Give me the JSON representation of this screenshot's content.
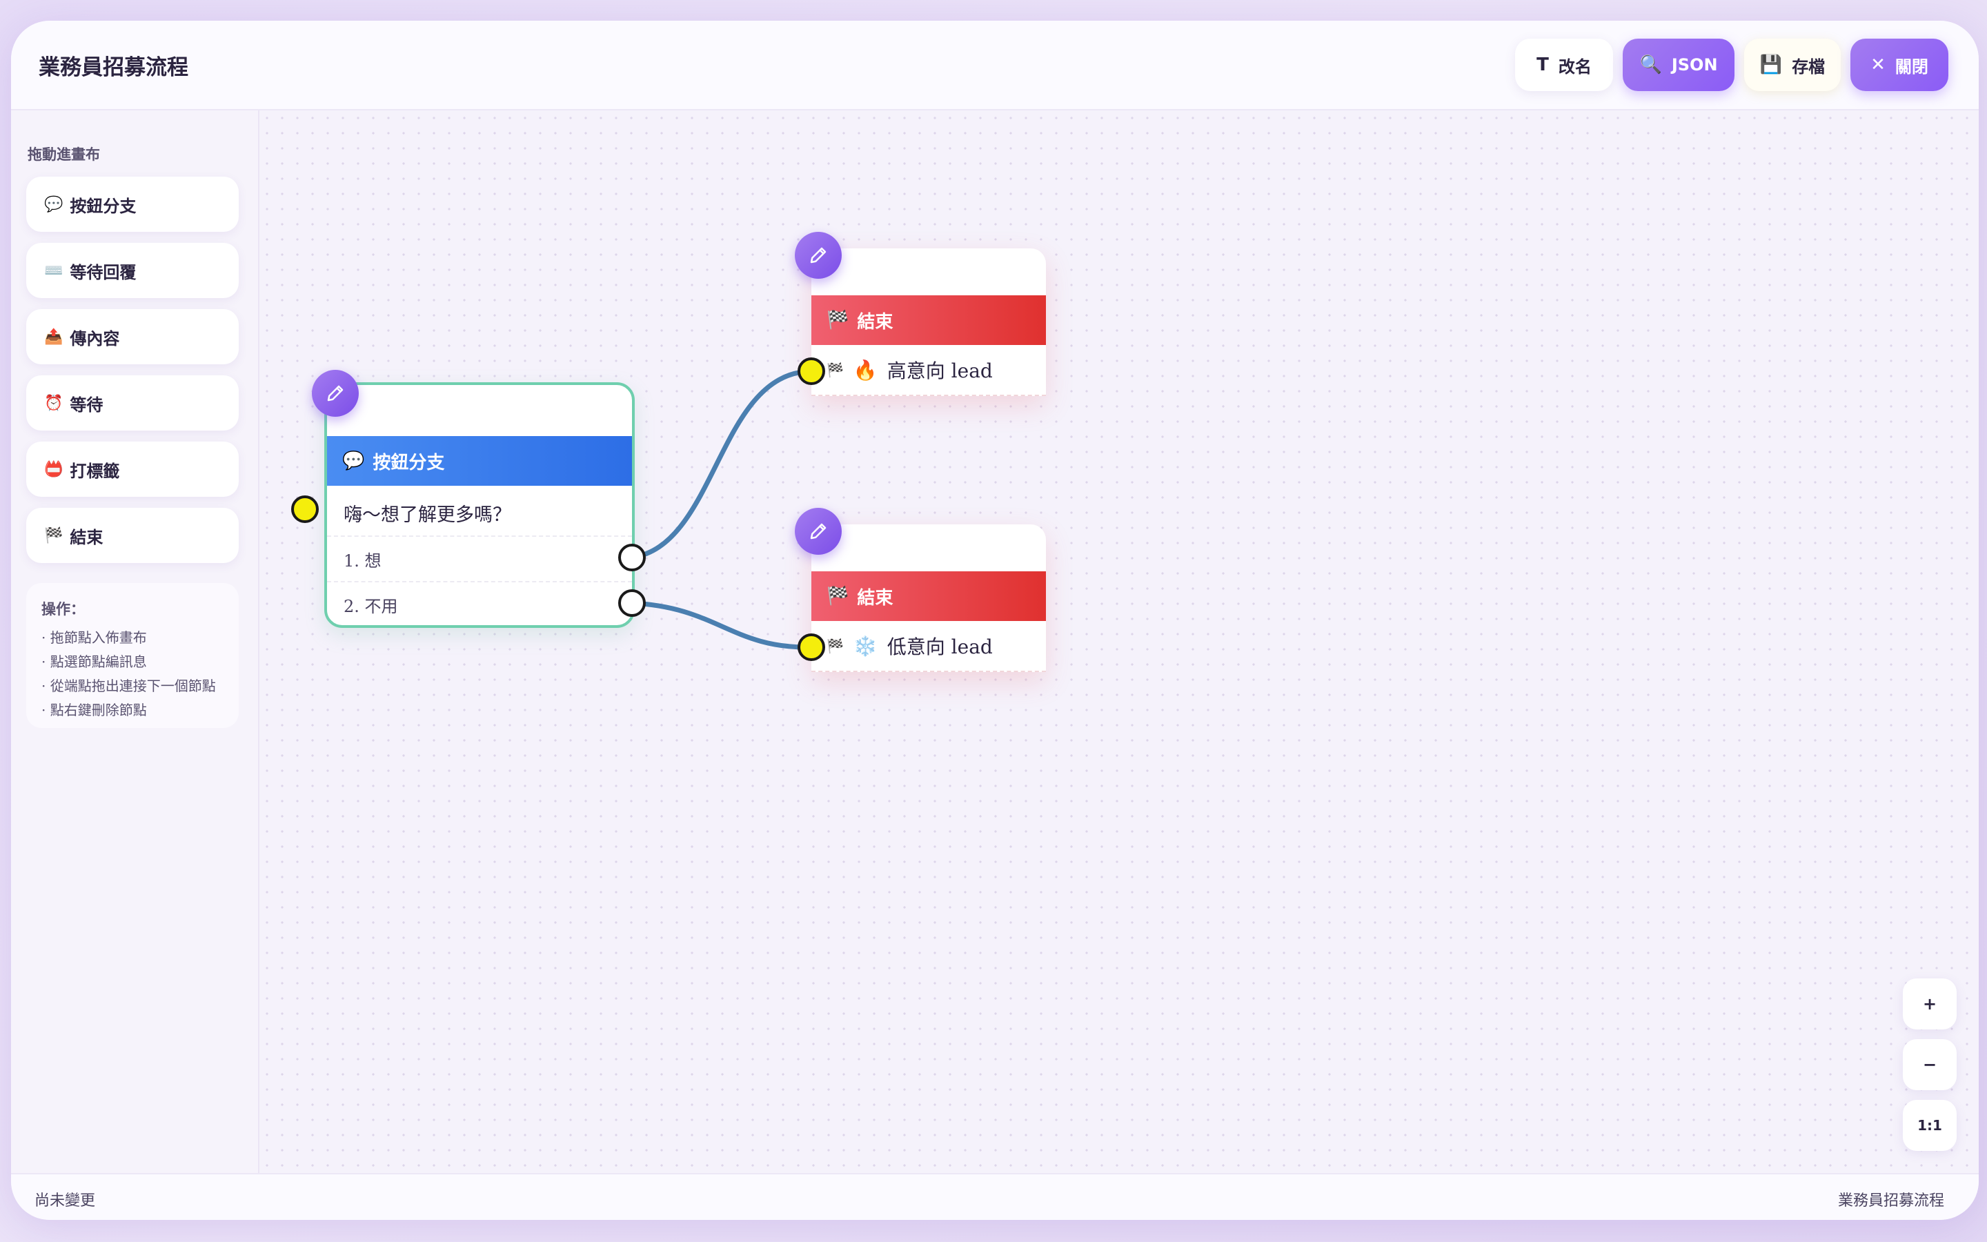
{
  "header": {
    "title": "業務員招募流程",
    "buttons": {
      "rename": {
        "icon": "T",
        "label": "改名"
      },
      "json": {
        "icon": "🔍",
        "label": "JSON"
      },
      "save": {
        "icon": "💾",
        "label": "存檔"
      },
      "close": {
        "icon": "✕",
        "label": "關閉"
      }
    }
  },
  "sidebar": {
    "title": "拖動進畫布",
    "items": [
      {
        "icon": "💬",
        "label": "按鈕分支"
      },
      {
        "icon": "⌨️",
        "label": "等待回覆"
      },
      {
        "icon": "📤",
        "label": "傳內容"
      },
      {
        "icon": "⏰",
        "label": "等待"
      },
      {
        "icon": "📛",
        "label": "打標籤"
      },
      {
        "icon": "🏁",
        "label": "結束"
      }
    ],
    "help": {
      "title": "操作：",
      "lines": [
        "· 拖節點入佈畫布",
        "· 點選節點編訊息",
        "· 從端點拖出連接下一個節點",
        "· 點右鍵刪除節點"
      ]
    }
  },
  "canvas": {
    "branch_node": {
      "icon": "💬",
      "title": "按鈕分支",
      "message": "嗨～想了解更多嗎？",
      "options": [
        "1. 想",
        "2. 不用"
      ]
    },
    "end_nodes": [
      {
        "header_icon": "🏁",
        "title": "結束",
        "flag_icon": "🏁",
        "label_icon": "🔥",
        "label": "高意向 lead"
      },
      {
        "header_icon": "🏁",
        "title": "結束",
        "flag_icon": "🏁",
        "label_icon": "❄️",
        "label": "低意向 lead"
      }
    ],
    "edge_color": "#4a7fb0",
    "port_in_color": "#f5ee0c"
  },
  "zoom": {
    "in": "+",
    "out": "−",
    "reset": "1:1"
  },
  "footer": {
    "status": "尚未變更",
    "flow_name": "業務員招募流程"
  }
}
